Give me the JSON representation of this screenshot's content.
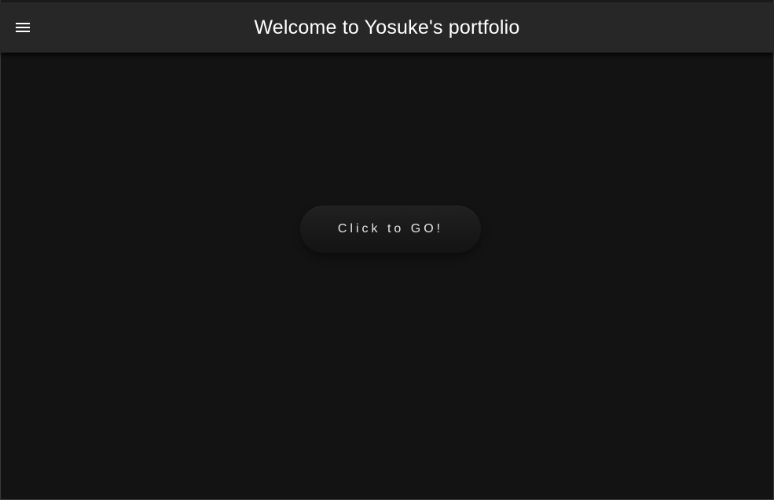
{
  "header": {
    "title": "Welcome to Yosuke's portfolio",
    "menu_icon": "hamburger-menu-icon"
  },
  "main": {
    "cta_label": "Click to GO!"
  },
  "colors": {
    "background": "#131313",
    "appbar": "#272727",
    "text": "#ffffff",
    "button_text": "#e6e6e6"
  }
}
